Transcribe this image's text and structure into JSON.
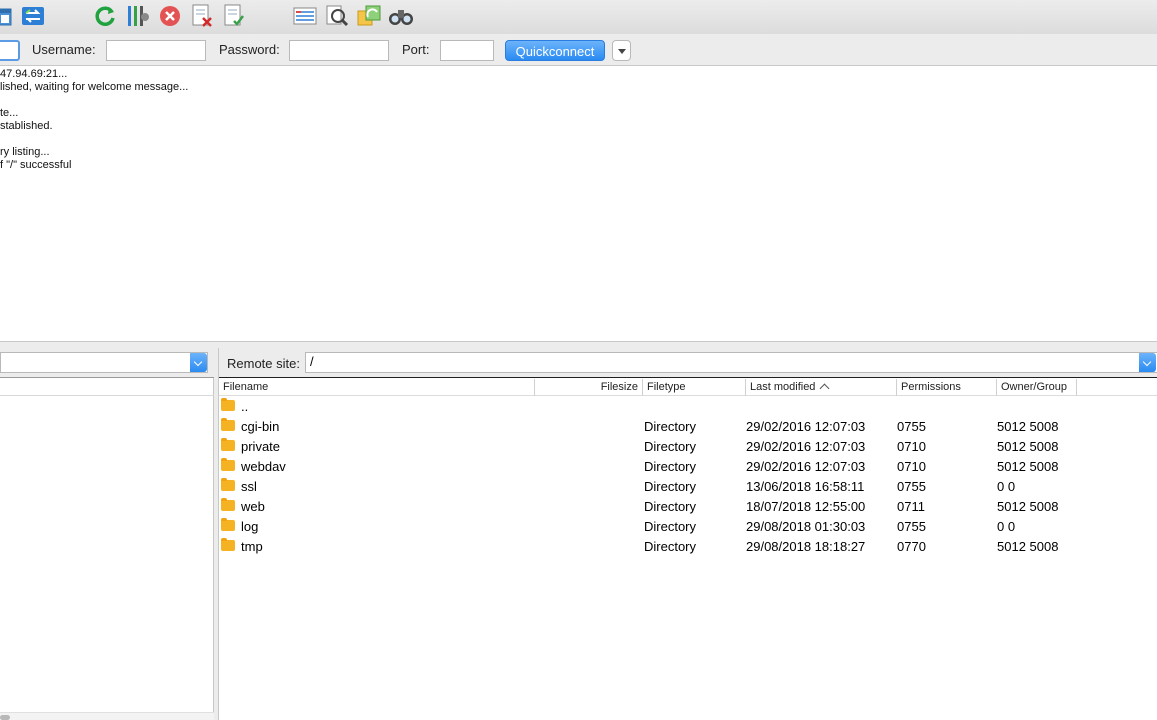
{
  "quickconnect": {
    "username_label": "Username:",
    "password_label": "Password:",
    "port_label": "Port:",
    "button_label": "Quickconnect",
    "host_value": "",
    "username_value": "",
    "password_value": "",
    "port_value": ""
  },
  "log": {
    "lines": [
      "47.94.69:21...",
      "lished, waiting for welcome message...",
      "",
      "te...",
      "stablished.",
      "",
      "ry listing...",
      "f \"/\" successful"
    ]
  },
  "remote": {
    "label": "Remote site:",
    "path": "/",
    "columns": [
      "Filename",
      "Filesize",
      "Filetype",
      "Last modified",
      "Permissions",
      "Owner/Group"
    ],
    "rows": [
      {
        "name": "..",
        "type": "",
        "modified": "",
        "perms": "",
        "owner": ""
      },
      {
        "name": "cgi-bin",
        "type": "Directory",
        "modified": "29/02/2016 12:07:03",
        "perms": "0755",
        "owner": "5012 5008"
      },
      {
        "name": "private",
        "type": "Directory",
        "modified": "29/02/2016 12:07:03",
        "perms": "0710",
        "owner": "5012 5008"
      },
      {
        "name": "webdav",
        "type": "Directory",
        "modified": "29/02/2016 12:07:03",
        "perms": "0710",
        "owner": "5012 5008"
      },
      {
        "name": "ssl",
        "type": "Directory",
        "modified": "13/06/2018 16:58:11",
        "perms": "0755",
        "owner": "0 0"
      },
      {
        "name": "web",
        "type": "Directory",
        "modified": "18/07/2018 12:55:00",
        "perms": "0711",
        "owner": "5012 5008"
      },
      {
        "name": "log",
        "type": "Directory",
        "modified": "29/08/2018 01:30:03",
        "perms": "0755",
        "owner": "0 0"
      },
      {
        "name": "tmp",
        "type": "Directory",
        "modified": "29/08/2018 18:18:27",
        "perms": "0770",
        "owner": "5012 5008"
      }
    ]
  },
  "icons": {
    "toolbar": [
      "site-manager-icon",
      "transfer-queue-icon",
      "refresh-icon",
      "process-queue-icon",
      "cancel-icon",
      "disconnect-icon",
      "reconnect-icon",
      "dir-listing-filter-icon",
      "compare-icon",
      "sync-browse-icon",
      "search-icon"
    ],
    "accent": "#2a8bf2",
    "folder": "#f5b323"
  }
}
